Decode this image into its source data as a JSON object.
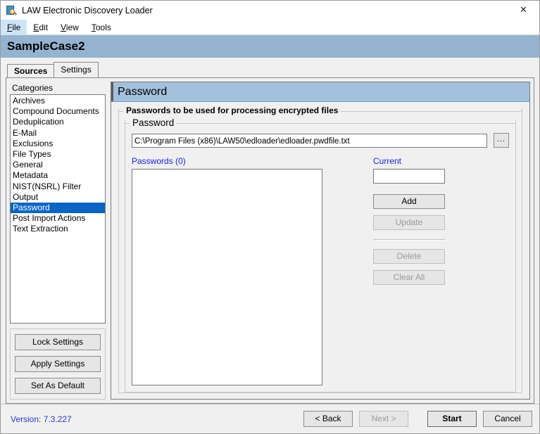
{
  "window": {
    "title": "LAW Electronic Discovery Loader",
    "icon": "app-magnifier-icon",
    "close_label": "✕"
  },
  "menubar": {
    "items": [
      {
        "label": "File",
        "accel": "F",
        "active": true
      },
      {
        "label": "Edit",
        "accel": "E",
        "active": false
      },
      {
        "label": "View",
        "accel": "V",
        "active": false
      },
      {
        "label": "Tools",
        "accel": "T",
        "active": false
      }
    ]
  },
  "case": {
    "name": "SampleCase2"
  },
  "tabs": [
    {
      "label": "Sources",
      "state": "completed"
    },
    {
      "label": "Settings",
      "state": "active"
    }
  ],
  "sidebar": {
    "categories_label": "Categories",
    "categories_accel": "g",
    "items": [
      {
        "label": "Archives",
        "selected": false
      },
      {
        "label": "Compound Documents",
        "selected": false
      },
      {
        "label": "Deduplication",
        "selected": false
      },
      {
        "label": "E-Mail",
        "selected": false
      },
      {
        "label": "Exclusions",
        "selected": false
      },
      {
        "label": "File Types",
        "selected": false
      },
      {
        "label": "General",
        "selected": false
      },
      {
        "label": "Metadata",
        "selected": false
      },
      {
        "label": "NIST(NSRL) Filter",
        "selected": false
      },
      {
        "label": "Output",
        "selected": false
      },
      {
        "label": "Password",
        "selected": true
      },
      {
        "label": "Post Import Actions",
        "selected": false
      },
      {
        "label": "Text Extraction",
        "selected": false
      }
    ],
    "buttons": [
      {
        "label": "Lock Settings",
        "enabled": true
      },
      {
        "label": "Apply Settings",
        "enabled": true
      },
      {
        "label": "Set As Default",
        "enabled": true
      }
    ]
  },
  "panel": {
    "header": "Password",
    "outer_group_title": "Passwords to be used for processing encrypted files",
    "inner_group_title": "Password",
    "path_value": "C:\\Program Files (x86)\\LAW50\\edloader\\edloader.pwdfile.txt",
    "browse_label": "...",
    "passwords_label": "Passwords (0)",
    "passwords_count": 0,
    "passwords_items": [],
    "current_label": "Current",
    "current_value": "",
    "buttons": [
      {
        "label": "Add",
        "enabled": true
      },
      {
        "label": "Update",
        "enabled": false
      },
      {
        "label": "Delete",
        "enabled": false
      },
      {
        "label": "Clear All",
        "enabled": false
      }
    ]
  },
  "footer": {
    "version": "Version: 7.3.227",
    "back_label": "< Back",
    "next_label": "Next >",
    "start_label": "Start",
    "cancel_label": "Cancel"
  },
  "colors": {
    "case_header_bg": "#94b3d1",
    "panel_header_bg": "#a3c1dd",
    "selection_bg": "#0a64c8",
    "link_blue": "#1a1af0",
    "version_blue": "#2a3ad0"
  }
}
